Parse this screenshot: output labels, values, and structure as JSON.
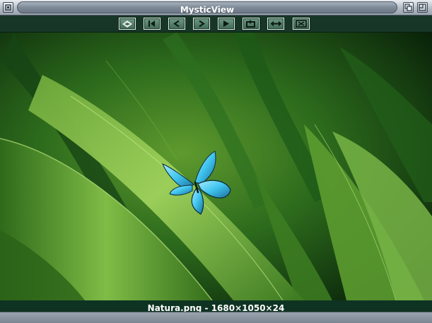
{
  "window": {
    "title": "MysticView",
    "depth_icon": "depth-icon",
    "zoom_icon": "zoom-icon"
  },
  "toolbar": {
    "buttons": [
      {
        "icon": "settings-icon"
      },
      {
        "icon": "first-image-icon"
      },
      {
        "icon": "previous-icon"
      },
      {
        "icon": "next-icon"
      },
      {
        "icon": "play-slideshow-icon"
      },
      {
        "icon": "loop-icon"
      },
      {
        "icon": "fit-width-icon"
      },
      {
        "icon": "close-fullscreen-icon"
      }
    ]
  },
  "image": {
    "subject": "butterfly-on-green-leaves",
    "colors": {
      "leaf_light": "#9ed05a",
      "leaf_dark": "#0f3a10",
      "butterfly": "#3fc4ee"
    }
  },
  "status": {
    "text": "Natura.png - 1680×1050×24"
  }
}
